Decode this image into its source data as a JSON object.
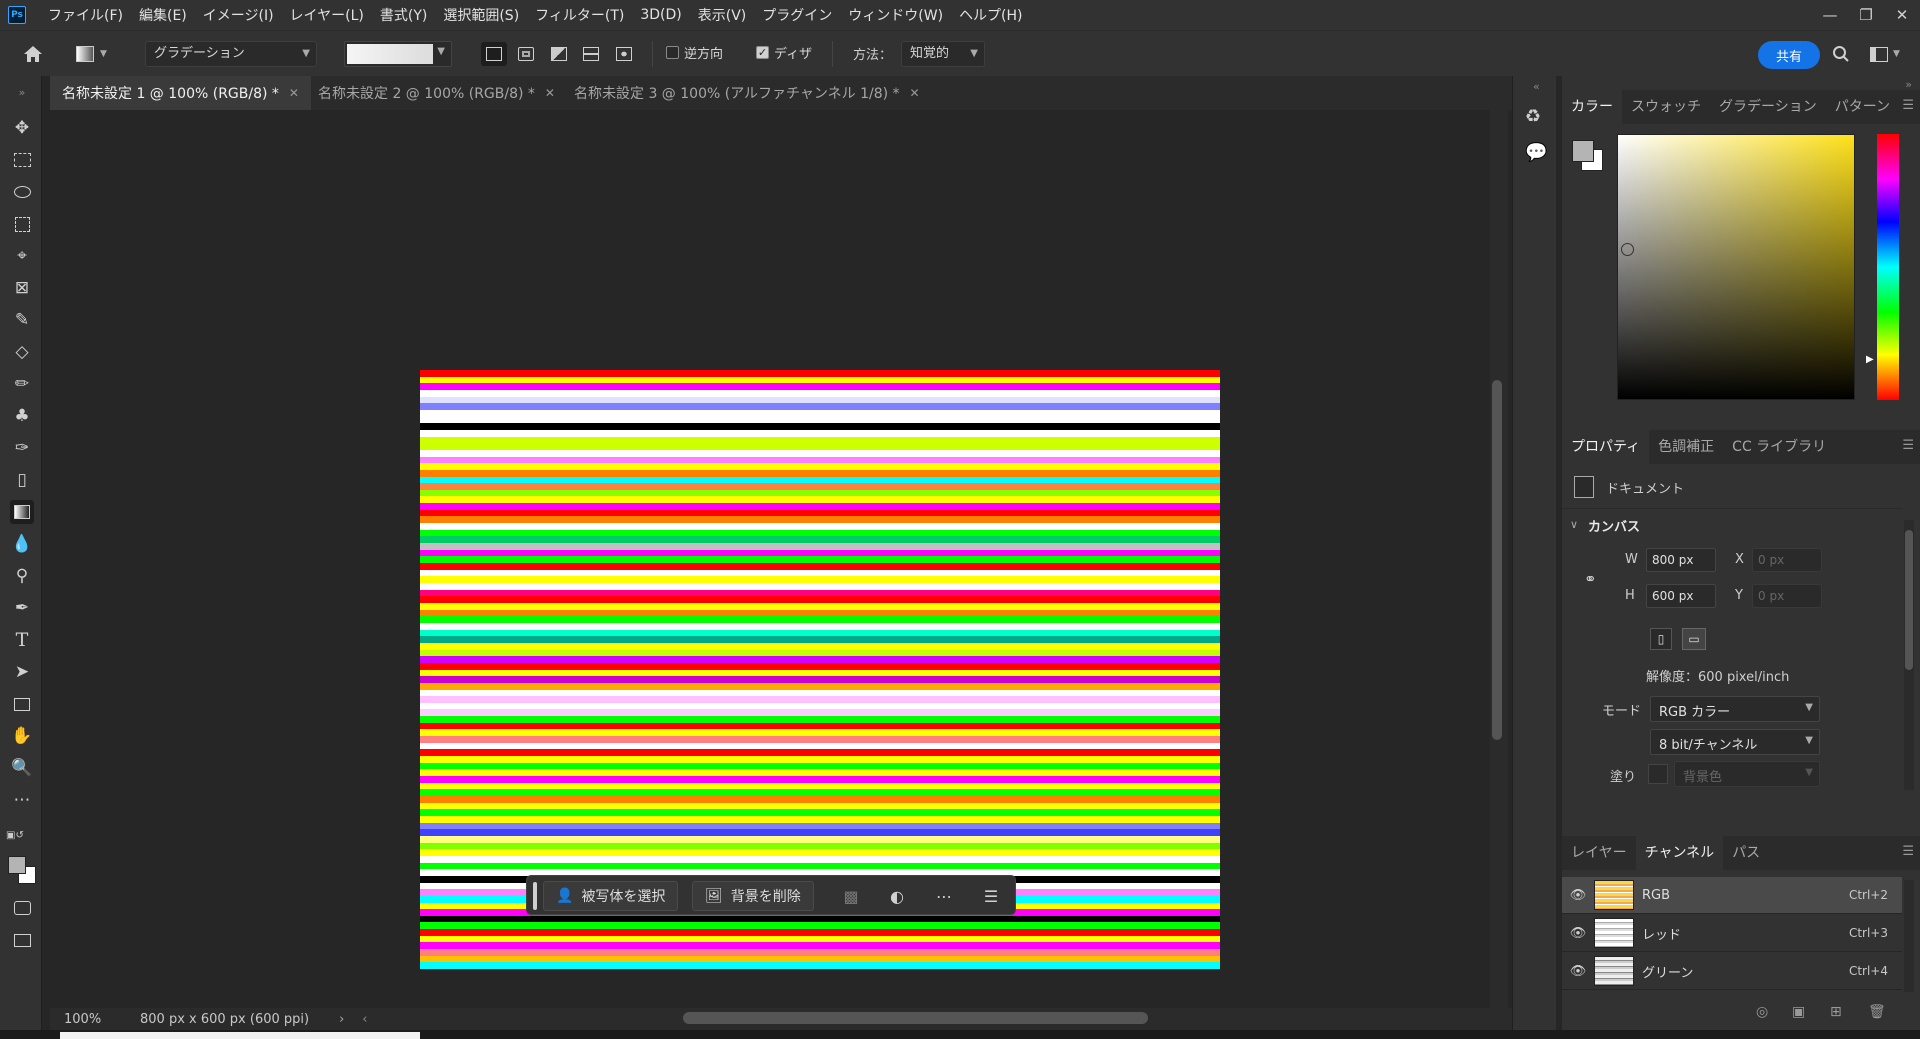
{
  "app": {
    "logo": "Ps"
  },
  "menu": [
    "ファイル(F)",
    "編集(E)",
    "イメージ(I)",
    "レイヤー(L)",
    "書式(Y)",
    "選択範囲(S)",
    "フィルター(T)",
    "3D(D)",
    "表示(V)",
    "プラグイン",
    "ウィンドウ(W)",
    "ヘルプ(H)"
  ],
  "window_controls": {
    "minimize": "—",
    "restore": "❐",
    "close": "✕"
  },
  "options": {
    "preset": "グラデーション",
    "reverse_label": "逆方向",
    "reverse_checked": false,
    "dither_label": "ディザ",
    "dither_checked": true,
    "method_label": "方法：",
    "method_value": "知覚的",
    "share_label": "共有"
  },
  "tabs": [
    {
      "label": "名称未設定 1 @ 100% (RGB/8) *",
      "active": true
    },
    {
      "label": "名称未設定 2 @ 100% (RGB/8) *",
      "active": false
    },
    {
      "label": "名称未設定 3 @ 100% (アルファチャンネル 1/8) *",
      "active": false
    }
  ],
  "stripes": [
    "#ff0000",
    "#ffff00",
    "#ff00ff",
    "#ffffff",
    "#e0e0ff",
    "#8080ff",
    "#ffffff",
    "#ffffff",
    "#000000",
    "#ffffff",
    "#d0ff00",
    "#ccff00",
    "#ffffff",
    "#ff80ff",
    "#ffff00",
    "#ff8000",
    "#00ffff",
    "#ff8040",
    "#88ff00",
    "#ffff00",
    "#ff00ff",
    "#ff0000",
    "#ff8000",
    "#ffffff",
    "#00ff00",
    "#00cc66",
    "#c0c0c0",
    "#ff00ff",
    "#00ff00",
    "#ff0000",
    "#ffffff",
    "#ffff00",
    "#ffffff",
    "#ff0080",
    "#ff0000",
    "#ffff00",
    "#ff8000",
    "#00ff00",
    "#ffffff",
    "#00ffcc",
    "#00aa88",
    "#ffff00",
    "#c0ff00",
    "#d000ff",
    "#ff0000",
    "#ffff00",
    "#cc00cc",
    "#ffaa00",
    "#ffffff",
    "#ffc0ff",
    "#ffffff",
    "#ffccff",
    "#00ff00",
    "#ff0000",
    "#ffff00",
    "#ff8080",
    "#ffffff",
    "#ff0000",
    "#ffff00",
    "#00ff00",
    "#ffff00",
    "#ff00ff",
    "#ffff00",
    "#00ff00",
    "#ff8000",
    "#ffff00",
    "#00ff00",
    "#ffff00",
    "#8080ff",
    "#4040ff",
    "#ffff80",
    "#80ff00",
    "#ffff00",
    "#ffffff",
    "#00ff00",
    "#ffffff",
    "#000000",
    "#ffffff",
    "#ff80ff",
    "#00ffff",
    "#ffff00",
    "#ff00ff",
    "#000000",
    "#00ff00",
    "#ff0000",
    "#ffff00",
    "#ff00ff",
    "#ff8080",
    "#ffc000",
    "#00ffff"
  ],
  "taskbar": {
    "select_subject": "被写体を選択",
    "remove_bg": "背景を削除"
  },
  "status": {
    "zoom": "100%",
    "doc_info": "800 px x 600 px (600 ppi)"
  },
  "color_panel": {
    "tabs": [
      "カラー",
      "スウォッチ",
      "グラデーション",
      "パターン"
    ]
  },
  "properties_panel": {
    "tabs": [
      "プロパティ",
      "色調補正",
      "CC ライブラリ"
    ],
    "doc_label": "ドキュメント",
    "canvas_title": "カンバス",
    "w_label": "W",
    "w_value": "800 px",
    "h_label": "H",
    "h_value": "600 px",
    "x_label": "X",
    "x_value": "0 px",
    "y_label": "Y",
    "y_value": "0 px",
    "resolution": "解像度：600 pixel/inch",
    "mode_label": "モード",
    "mode_value": "RGB カラー",
    "depth_value": "8 bit/チャンネル",
    "fill_label": "塗り",
    "fill_value": "背景色"
  },
  "channels_panel": {
    "tabs": [
      "レイヤー",
      "チャンネル",
      "パス"
    ],
    "rows": [
      {
        "name": "RGB",
        "shortcut": "Ctrl+2"
      },
      {
        "name": "レッド",
        "shortcut": "Ctrl+3"
      },
      {
        "name": "グリーン",
        "shortcut": "Ctrl+4"
      }
    ]
  }
}
